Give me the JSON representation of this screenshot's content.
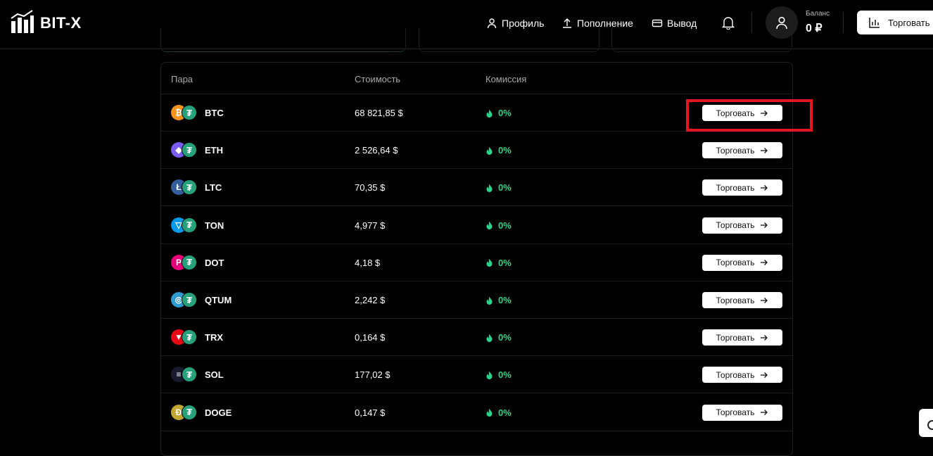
{
  "header": {
    "logo_text": "BIT-X",
    "nav": {
      "profile": "Профиль",
      "deposit": "Пополнение",
      "withdraw": "Вывод"
    },
    "balance": {
      "label": "Баланс",
      "value": "0 ₽"
    },
    "trade_button": "Торговать"
  },
  "table": {
    "columns": {
      "pair": "Пара",
      "price": "Стоимость",
      "fee": "Комиссия"
    },
    "rows": [
      {
        "symbol": "BTC",
        "price": "68 821,85 $",
        "fee": "0%",
        "action": "Торговать",
        "icon": "bitcoin-icon",
        "color": "#f7931a",
        "glyph": "₿"
      },
      {
        "symbol": "ETH",
        "price": "2 526,64 $",
        "fee": "0%",
        "action": "Торговать",
        "icon": "ethereum-icon",
        "color": "#7b5cf0",
        "glyph": "◆"
      },
      {
        "symbol": "LTC",
        "price": "70,35 $",
        "fee": "0%",
        "action": "Торговать",
        "icon": "litecoin-icon",
        "color": "#345d9d",
        "glyph": "Ł"
      },
      {
        "symbol": "TON",
        "price": "4,977 $",
        "fee": "0%",
        "action": "Торговать",
        "icon": "toncoin-icon",
        "color": "#0098ea",
        "glyph": "▽"
      },
      {
        "symbol": "DOT",
        "price": "4,18 $",
        "fee": "0%",
        "action": "Торговать",
        "icon": "polkadot-icon",
        "color": "#e6007a",
        "glyph": "P"
      },
      {
        "symbol": "QTUM",
        "price": "2,242 $",
        "fee": "0%",
        "action": "Торговать",
        "icon": "qtum-icon",
        "color": "#2e9ad0",
        "glyph": "◎"
      },
      {
        "symbol": "TRX",
        "price": "0,164 $",
        "fee": "0%",
        "action": "Торговать",
        "icon": "tron-icon",
        "color": "#e50915",
        "glyph": "▼"
      },
      {
        "symbol": "SOL",
        "price": "177,02 $",
        "fee": "0%",
        "action": "Торговать",
        "icon": "solana-icon",
        "color": "#1a1a2e",
        "glyph": "≡"
      },
      {
        "symbol": "DOGE",
        "price": "0,147 $",
        "fee": "0%",
        "action": "Торговать",
        "icon": "dogecoin-icon",
        "color": "#c2a633",
        "glyph": "Ð"
      }
    ],
    "usdt_glyph": "₮"
  },
  "colors": {
    "accent_green": "#2ad38a",
    "highlight_red": "#e3161f",
    "tether_green": "#26a17b"
  }
}
